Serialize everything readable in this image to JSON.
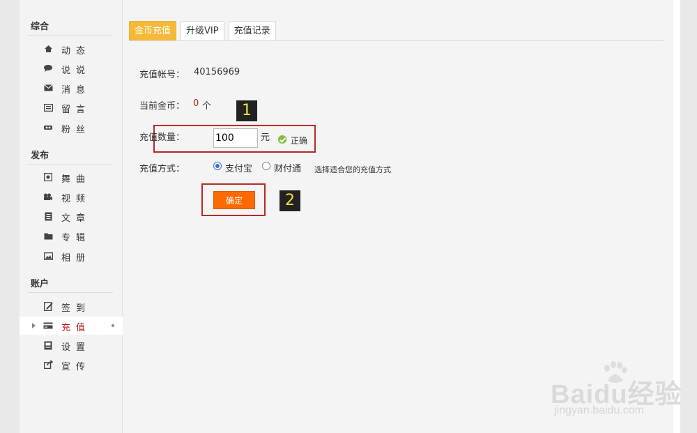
{
  "sidebar": {
    "sections": [
      {
        "title": "综合",
        "items": [
          {
            "label": "动态",
            "icon": "home-icon"
          },
          {
            "label": "说说",
            "icon": "chat-icon"
          },
          {
            "label": "消息",
            "icon": "envelope-icon"
          },
          {
            "label": "留言",
            "icon": "message-board-icon"
          },
          {
            "label": "粉丝",
            "icon": "fans-icon"
          }
        ]
      },
      {
        "title": "发布",
        "items": [
          {
            "label": "舞曲",
            "icon": "music-icon"
          },
          {
            "label": "视频",
            "icon": "video-camera-icon"
          },
          {
            "label": "文章",
            "icon": "document-icon"
          },
          {
            "label": "专辑",
            "icon": "folder-icon"
          },
          {
            "label": "相册",
            "icon": "image-icon"
          }
        ]
      },
      {
        "title": "账户",
        "items": [
          {
            "label": "签到",
            "icon": "checkin-icon"
          },
          {
            "label": "充值",
            "icon": "card-icon",
            "active": true
          },
          {
            "label": "设置",
            "icon": "settings-icon"
          },
          {
            "label": "宣传",
            "icon": "share-icon"
          }
        ]
      }
    ]
  },
  "tabs": [
    "金币充值",
    "升级VIP",
    "充值记录"
  ],
  "form": {
    "account_label": "充值帐号：",
    "account_value": "40156969",
    "coins_label": "当前金币：",
    "coins_value": "0",
    "coins_unit": "个",
    "amount_label": "充值数量：",
    "amount_value": "100",
    "amount_unit": "元",
    "valid_text": "正确",
    "method_label": "充值方式：",
    "method_options": [
      "支付宝",
      "财付通"
    ],
    "method_selected": "支付宝",
    "method_hint": "选择适合您的充值方式",
    "confirm_label": "确定"
  },
  "markers": [
    "1",
    "2"
  ],
  "colors": {
    "accent_tab": "#f5b93a",
    "confirm": "#ff6a00",
    "highlight": "#b52a2a",
    "active_text": "#b21f1f"
  },
  "watermark": {
    "brand": "Baidu经验",
    "url": "jingyan.baidu.com"
  }
}
